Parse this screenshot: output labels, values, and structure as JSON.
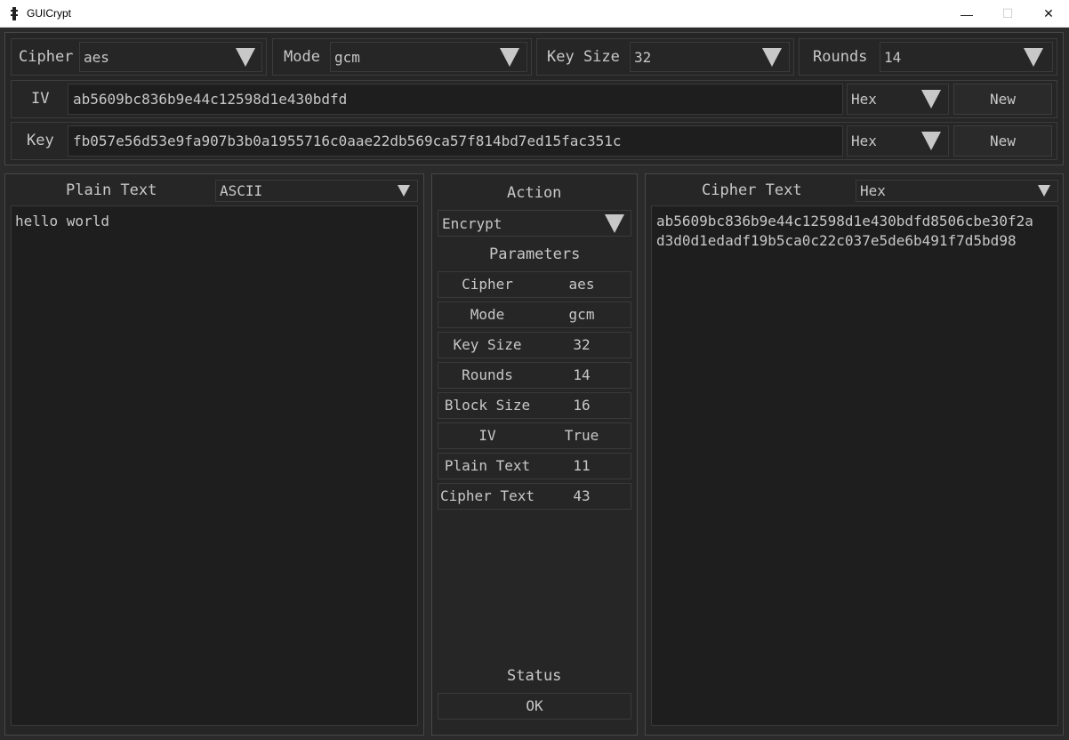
{
  "window": {
    "title": "GUICrypt",
    "minimize": "—",
    "maximize": "☐",
    "close": "✕"
  },
  "top": {
    "cipher": {
      "label": "Cipher",
      "value": "aes"
    },
    "mode": {
      "label": "Mode",
      "value": "gcm"
    },
    "key_size": {
      "label": "Key Size",
      "value": "32"
    },
    "rounds": {
      "label": "Rounds",
      "value": "14"
    },
    "iv": {
      "label": "IV",
      "value": "ab5609bc836b9e44c12598d1e430bdfd",
      "encoding": "Hex",
      "new_label": "New"
    },
    "key": {
      "label": "Key",
      "value": "fb057e56d53e9fa907b3b0a1955716c0aae22db569ca57f814bd7ed15fac351c",
      "encoding": "Hex",
      "new_label": "New"
    }
  },
  "plain": {
    "label": "Plain Text",
    "encoding": "ASCII",
    "text": "hello world"
  },
  "middle": {
    "action_label": "Action",
    "action_value": "Encrypt",
    "parameters_label": "Parameters",
    "params": [
      {
        "key": "Cipher",
        "value": "aes"
      },
      {
        "key": "Mode",
        "value": "gcm"
      },
      {
        "key": "Key Size",
        "value": "32"
      },
      {
        "key": "Rounds",
        "value": "14"
      },
      {
        "key": "Block Size",
        "value": "16"
      },
      {
        "key": "IV",
        "value": "True"
      },
      {
        "key": "Plain Text",
        "value": "11"
      },
      {
        "key": "Cipher Text",
        "value": "43"
      }
    ],
    "status_label": "Status",
    "status_value": "OK"
  },
  "cipher_text": {
    "label": "Cipher Text",
    "encoding": "Hex",
    "text": "ab5609bc836b9e44c12598d1e430bdfd8506cbe30f2ad3d0d1edadf19b5ca0c22c037e5de6b491f7d5bd98"
  }
}
